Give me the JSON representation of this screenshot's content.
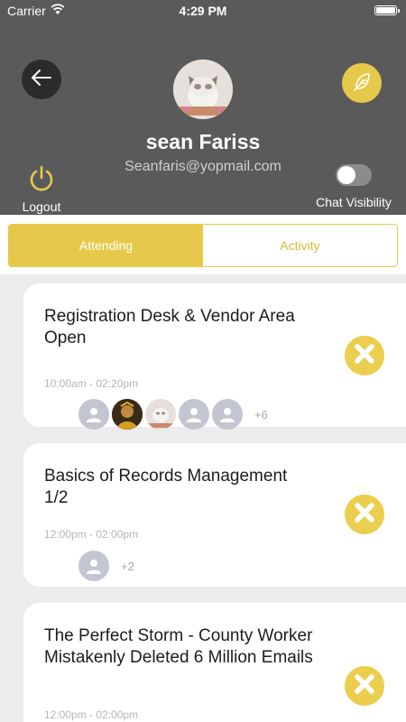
{
  "status_bar": {
    "carrier": "Carrier",
    "time": "4:29 PM"
  },
  "profile": {
    "name": "sean Fariss",
    "email": "Seanfaris@yopmail.com",
    "logout_label": "Logout",
    "chat_visibility_label": "Chat Visibility",
    "chat_visibility_on": false
  },
  "tabs": [
    {
      "label": "Attending",
      "active": true
    },
    {
      "label": "Activity",
      "active": false
    }
  ],
  "events": [
    {
      "title": "Registration Desk & Vendor Area Open",
      "time": "10:00am - 02:20pm",
      "attendees": [
        "default",
        "photo-dark",
        "photo-cat",
        "default",
        "default"
      ],
      "more": "+6"
    },
    {
      "title": "Basics of Records Management 1/2",
      "time": "12:00pm - 02:00pm",
      "attendees": [
        "default"
      ],
      "more": "+2"
    },
    {
      "title": "The Perfect Storm - County Worker Mistakenly Deleted 6 Million Emails",
      "time": "12:00pm - 02:00pm",
      "attendees": [],
      "more": ""
    }
  ],
  "colors": {
    "accent": "#e6c94b",
    "header_bg": "#5a5a5a",
    "list_bg": "#ececec"
  },
  "icons": {
    "back": "arrow-left-icon",
    "edit": "feather-icon",
    "logout": "power-icon",
    "cancel": "close-icon"
  }
}
